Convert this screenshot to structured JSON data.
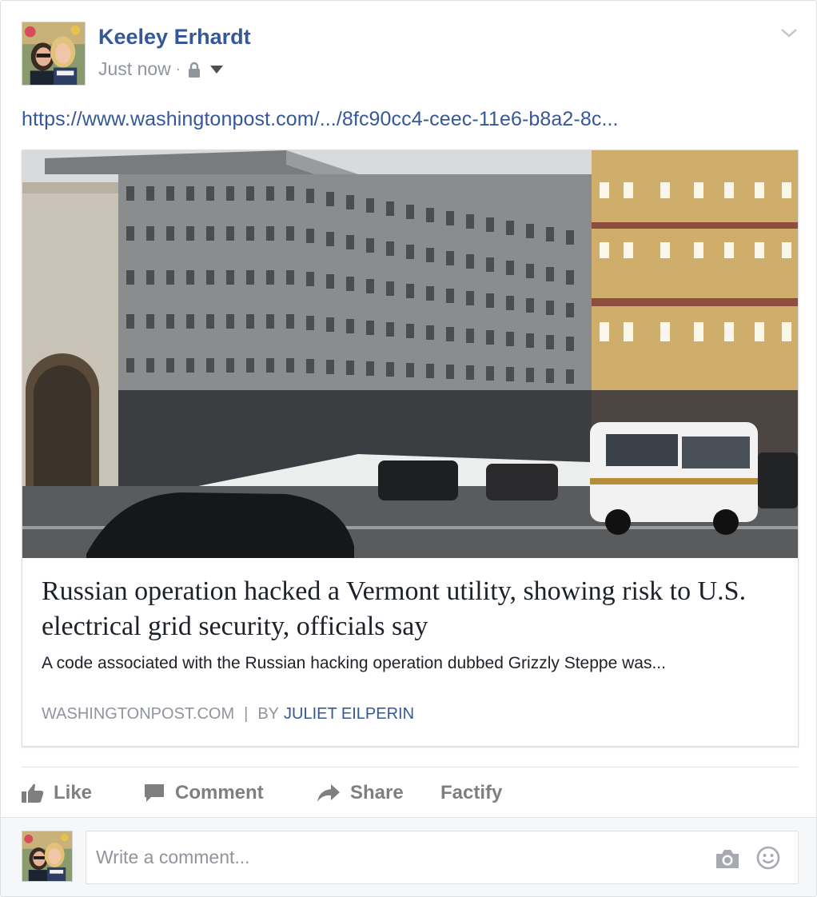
{
  "post": {
    "author": "Keeley Erhardt",
    "timestamp": "Just now",
    "separator": "·",
    "audience_icon": "lock-icon",
    "link_text": "https://www.washingtonpost.com/.../8fc90cc4-ceec-11e6-b8a2-8c...",
    "menu_icon": "chevron-down-icon"
  },
  "card": {
    "image_description_icon": "building-photo",
    "title": "Russian operation hacked a Vermont utility, showing risk to U.S. electrical grid security, officials say",
    "description": "A code associated with the Russian hacking operation dubbed Grizzly Steppe was...",
    "source": "WASHINGTONPOST.COM",
    "separator": "|",
    "byline_prefix": "BY",
    "byline_author": "JULIET EILPERIN"
  },
  "actions": {
    "like": "Like",
    "comment": "Comment",
    "share": "Share",
    "factify": "Factify"
  },
  "comment_box": {
    "placeholder": "Write a comment..."
  },
  "colors": {
    "link_blue": "#365899",
    "meta_gray": "#90949c",
    "action_gray": "#7f7f7f"
  }
}
